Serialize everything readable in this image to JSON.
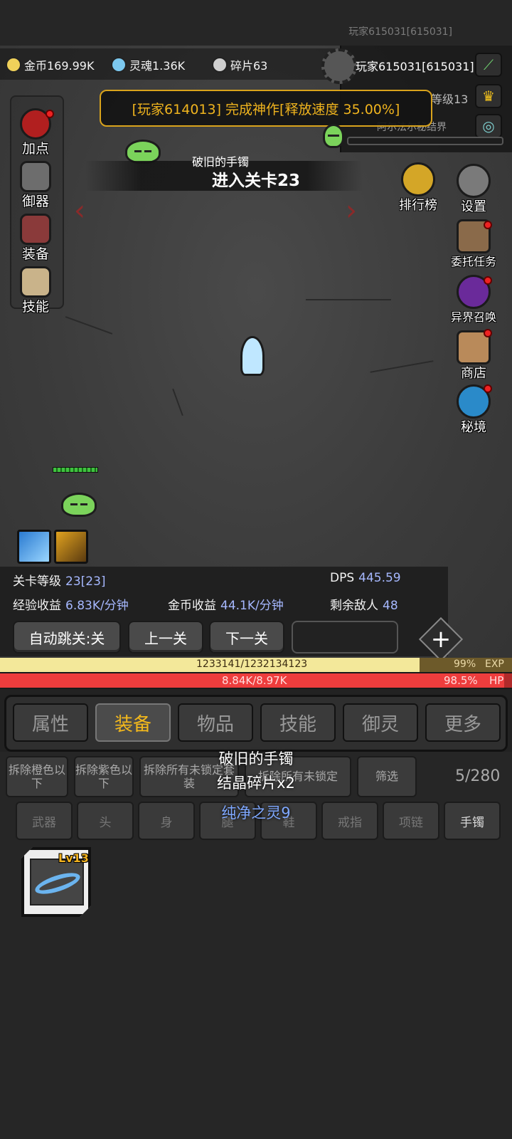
{
  "top": {
    "player_id_faded": "玩家615031[615031]"
  },
  "resources": {
    "gold": "金币169.99K",
    "soul": "灵魂1.36K",
    "shard": "碎片63"
  },
  "player": {
    "name": "玩家615031[615031]",
    "level": "等级13",
    "realm": "阿尔法尔秘结界"
  },
  "banner": "[玩家614013] 完成神作[释放速度 35.00%]",
  "stage": {
    "drop_item": "破旧的手镯",
    "title": "进入关卡23"
  },
  "left_menu": [
    {
      "label": "加点"
    },
    {
      "label": "御器"
    },
    {
      "label": "装备"
    },
    {
      "label": "技能"
    }
  ],
  "right_menu": {
    "ranking": "排行榜",
    "settings": "设置",
    "quest": "委托任务",
    "summon": "异界召唤",
    "shop": "商店",
    "secret": "秘境"
  },
  "stats": {
    "stage_level_label": "关卡等级",
    "stage_level_value": "23[23]",
    "dps_label": "DPS",
    "dps_value": "445.59",
    "exp_label": "经验收益",
    "exp_value": "6.83K/分钟",
    "gold_label": "金币收益",
    "gold_value": "44.1K/分钟",
    "enemies_label": "剩余敌人",
    "enemies_value": "48"
  },
  "controls": {
    "auto_skip": "自动跳关:关",
    "prev": "上一关",
    "next": "下一关"
  },
  "exp_bar": {
    "text": "1233141/1232134123",
    "percent": "99%",
    "label": "EXP",
    "fill": 0.82
  },
  "hp_bar": {
    "text": "8.84K/8.97K",
    "percent": "98.5%",
    "label": "HP",
    "fill": 0.985
  },
  "tabs": [
    "属性",
    "装备",
    "物品",
    "技能",
    "御灵",
    "更多"
  ],
  "active_tab": "装备",
  "equip_actions": {
    "dismantle_orange": "拆除橙色以下",
    "dismantle_purple": "拆除紫色以下",
    "dismantle_unlocked": "拆除所有未锁定套装",
    "dismantle_unlocked2": "拆除所有未锁定",
    "filter": "筛选",
    "count": "5/280"
  },
  "categories": [
    "武器",
    "头",
    "身",
    "腿",
    "鞋",
    "戒指",
    "项链",
    "手镯"
  ],
  "tooltip": {
    "name": "破旧的手镯",
    "reward": "结晶碎片x2",
    "bonus": "纯净之灵9"
  },
  "item": {
    "level": "Lv13"
  },
  "colors": {
    "accent_gold": "#f3b81c",
    "exp_fill": "#f3e89a",
    "hp_fill": "#ee3d3d",
    "stat_value": "#a6b8ff"
  }
}
